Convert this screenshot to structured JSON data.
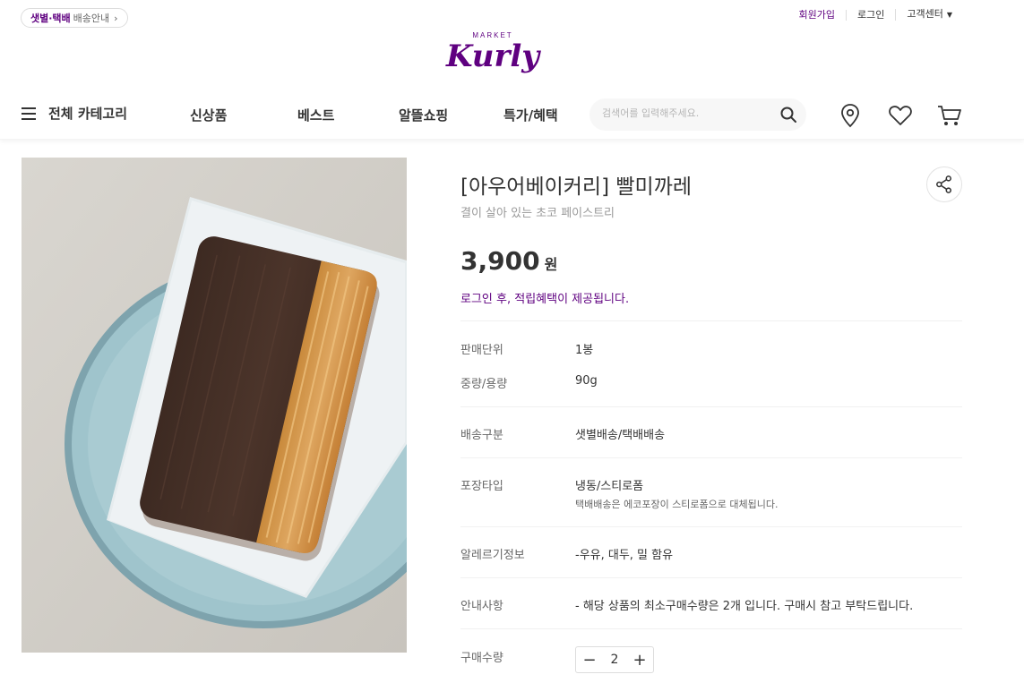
{
  "topbar": {
    "delivery_purple": "샛별·택배",
    "delivery_text": "배송안내",
    "chevron": "›",
    "links": [
      "회원가입",
      "로그인",
      "고객센터"
    ]
  },
  "logo": {
    "small": "MARKET",
    "main": "Kurly"
  },
  "nav": {
    "category": "전체 카테고리",
    "menu": [
      "신상품",
      "베스트",
      "알뜰쇼핑",
      "특가/혜택"
    ],
    "search_placeholder": "검색어를 입력해주세요."
  },
  "product": {
    "title": "[아우어베이커리] 빨미까레",
    "subtitle": "결이 살아 있는 초코 페이스트리",
    "price": "3,900",
    "currency": "원",
    "notice": "로그인 후, 적립혜택이 제공됩니다.",
    "details": [
      {
        "label": "판매단위",
        "value": "1봉"
      },
      {
        "label": "중량/용량",
        "value": "90g"
      },
      {
        "label": "배송구분",
        "value": "샛별배송/택배배송"
      },
      {
        "label": "포장타입",
        "value": "냉동/스티로폼",
        "sub": "택배배송은 에코포장이 스티로폼으로 대체됩니다."
      },
      {
        "label": "알레르기정보",
        "value": "-우유, 대두, 밀 함유"
      },
      {
        "label": "안내사항",
        "value": "- 해당 상품의 최소구매수량은 2개 입니다. 구매시 참고 부탁드립니다."
      }
    ],
    "quantity_label": "구매수량",
    "quantity": "2",
    "minus": "−",
    "plus": "+"
  },
  "colors": {
    "brand": "#5f0080"
  },
  "icons": [
    "menu-icon",
    "search-icon",
    "location-pin-icon",
    "heart-icon",
    "cart-icon",
    "share-icon",
    "chevron-down-icon"
  ]
}
